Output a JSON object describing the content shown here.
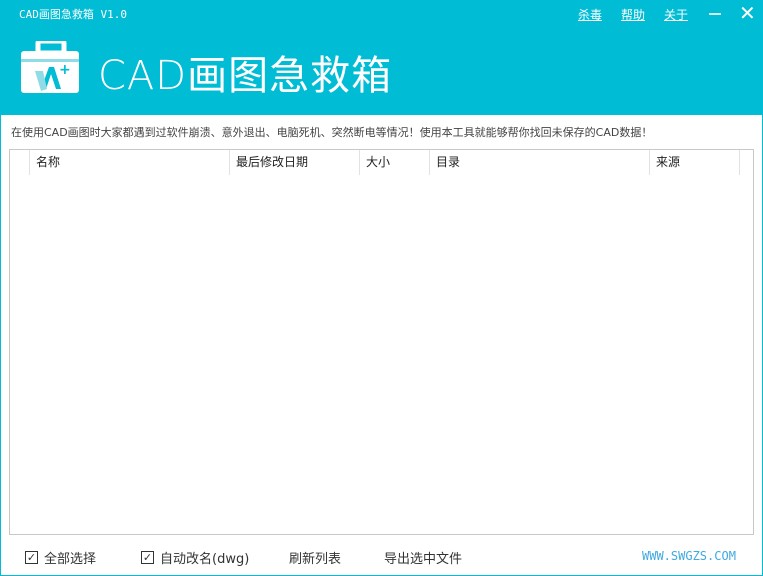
{
  "window": {
    "title": "CAD画图急救箱 V1.0",
    "links": [
      "杀毒",
      "帮助",
      "关于"
    ],
    "minimize": "–",
    "close": "✕"
  },
  "header": {
    "app_title": "CAD画图急救箱"
  },
  "description": "在使用CAD画图时大家都遇到过软件崩溃、意外退出、电脑死机、突然断电等情况！使用本工具就能够帮你找回未保存的CAD数据！",
  "table": {
    "columns": [
      "名称",
      "最后修改日期",
      "大小",
      "目录",
      "来源"
    ],
    "rows": []
  },
  "footer": {
    "select_all": "全部选择",
    "select_all_checked": true,
    "auto_rename": "自动改名(dwg)",
    "auto_rename_checked": true,
    "refresh": "刷新列表",
    "export": "导出选中文件",
    "website": "WWW.SWGZS.COM",
    "check": "✓"
  },
  "colors": {
    "accent": "#00bcd4",
    "link": "#3fa9e0"
  }
}
